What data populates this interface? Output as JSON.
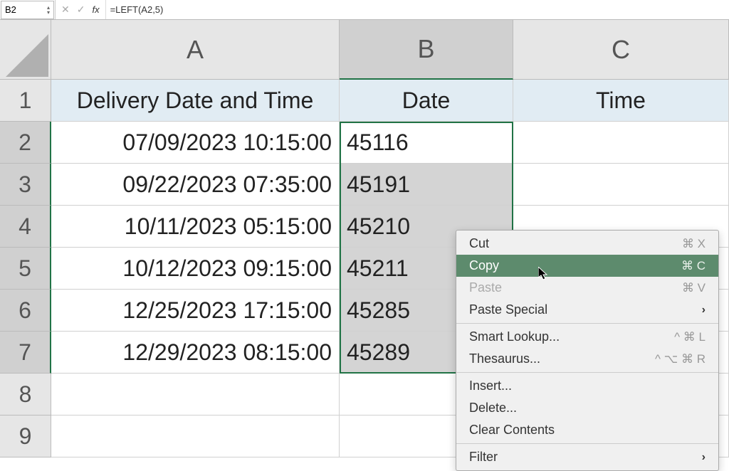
{
  "formulaBar": {
    "cellRef": "B2",
    "formula": "=LEFT(A2,5)"
  },
  "columns": [
    "A",
    "B",
    "C"
  ],
  "rows": [
    "1",
    "2",
    "3",
    "4",
    "5",
    "6",
    "7",
    "8",
    "9"
  ],
  "headers": {
    "A": "Delivery Date and Time",
    "B": "Date",
    "C": "Time"
  },
  "data": [
    {
      "A": "07/09/2023 10:15:00",
      "B": "45116",
      "C": ""
    },
    {
      "A": "09/22/2023 07:35:00",
      "B": "45191",
      "C": ""
    },
    {
      "A": "10/11/2023 05:15:00",
      "B": "45210",
      "C": ""
    },
    {
      "A": "10/12/2023 09:15:00",
      "B": "45211",
      "C": ""
    },
    {
      "A": "12/25/2023 17:15:00",
      "B": "45285",
      "C": ""
    },
    {
      "A": "12/29/2023 08:15:00",
      "B": "45289",
      "C": ""
    },
    {
      "A": "",
      "B": "",
      "C": ""
    },
    {
      "A": "",
      "B": "",
      "C": ""
    }
  ],
  "contextMenu": {
    "cut": {
      "label": "Cut",
      "shortcut": "⌘ X"
    },
    "copy": {
      "label": "Copy",
      "shortcut": "⌘ C"
    },
    "paste": {
      "label": "Paste",
      "shortcut": "⌘ V"
    },
    "pasteSpecial": {
      "label": "Paste Special"
    },
    "smartLookup": {
      "label": "Smart Lookup...",
      "shortcut": "^ ⌘ L"
    },
    "thesaurus": {
      "label": "Thesaurus...",
      "shortcut": "^ ⌥ ⌘ R"
    },
    "insert": {
      "label": "Insert..."
    },
    "delete": {
      "label": "Delete..."
    },
    "clearContents": {
      "label": "Clear Contents"
    },
    "filter": {
      "label": "Filter"
    }
  }
}
